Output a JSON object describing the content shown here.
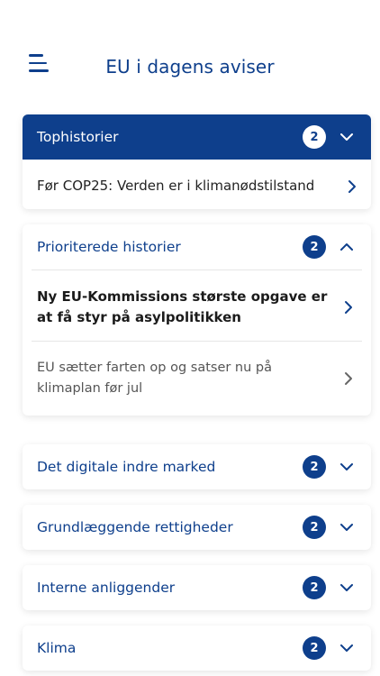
{
  "header": {
    "title": "EU i dagens aviser"
  },
  "sections": [
    {
      "label": "Tophistorier",
      "count": "2",
      "expanded": true,
      "items": [
        {
          "text": "Før COP25: Verden er i klimanødstilstand"
        }
      ]
    },
    {
      "label": "Prioriterede historier",
      "count": "2",
      "expanded": true,
      "items": [
        {
          "text": "Ny EU-Kommissions største opgave er at få styr på asylpolitikken"
        },
        {
          "text": "EU sætter farten op og satser nu på klimaplan før jul"
        }
      ]
    },
    {
      "label": "Det digitale indre marked",
      "count": "2",
      "expanded": false
    },
    {
      "label": "Grundlæggende rettigheder",
      "count": "2",
      "expanded": false
    },
    {
      "label": "Interne anliggender",
      "count": "2",
      "expanded": false
    },
    {
      "label": "Klima",
      "count": "2",
      "expanded": false
    }
  ],
  "colors": {
    "brand": "#0e3f8c"
  },
  "icons": {
    "menu": "hamburger-menu-icon",
    "down": "chevron-down-icon",
    "up": "chevron-up-icon",
    "right": "chevron-right-icon"
  }
}
